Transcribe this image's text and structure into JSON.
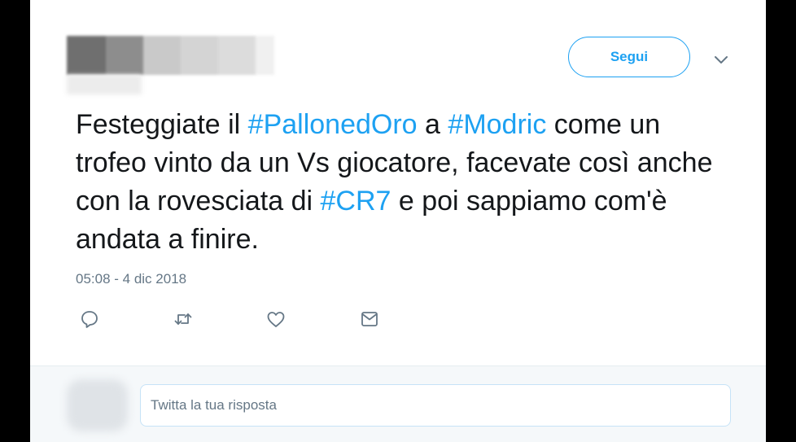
{
  "header": {
    "follow_label": "Segui"
  },
  "tweet": {
    "segments": [
      {
        "text": "Festeggiate il ",
        "hashtag": false
      },
      {
        "text": "#PallonedOro",
        "hashtag": true
      },
      {
        "text": " a ",
        "hashtag": false
      },
      {
        "text": "#Modric",
        "hashtag": true
      },
      {
        "text": " come un trofeo vinto da un Vs giocatore, facevate così anche con la rovesciata di ",
        "hashtag": false
      },
      {
        "text": "#CR7",
        "hashtag": true
      },
      {
        "text": " e poi sappiamo com'è andata a finire.",
        "hashtag": false
      }
    ],
    "timestamp": "05:08 - 4 dic 2018"
  },
  "actions": [
    "reply-icon",
    "retweet-icon",
    "like-icon",
    "direct-message-icon"
  ],
  "reply": {
    "placeholder": "Twitta la tua risposta"
  },
  "colors": {
    "accent": "#1da1f2",
    "text": "#14171a",
    "muted": "#657786",
    "reply_bg": "#f5f8fa"
  }
}
